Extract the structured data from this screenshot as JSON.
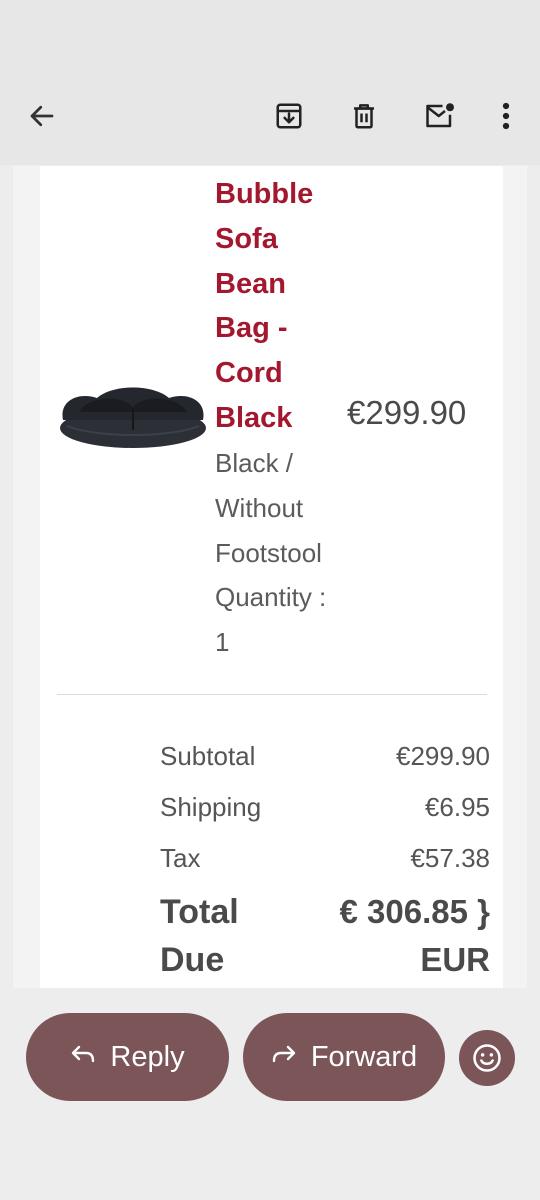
{
  "toolbar": {
    "back_icon": "arrow-left-icon",
    "archive_icon": "archive-icon",
    "delete_icon": "trash-icon",
    "mark_unread_icon": "mail-unread-icon",
    "more_icon": "more-vertical-icon"
  },
  "product": {
    "title_lines": [
      "Bubble",
      "Sofa",
      "Bean",
      "Bag -",
      "Cord",
      "Black"
    ],
    "variant_lines": [
      "Black /",
      "Without",
      "Footstool",
      "Quantity :",
      "1"
    ],
    "price": "€299.90",
    "image": "bean-bag-sofa-image"
  },
  "summary": {
    "subtotal_label": "Subtotal",
    "subtotal_value": "€299.90",
    "shipping_label": "Shipping",
    "shipping_value": "€6.95",
    "tax_label": "Tax",
    "tax_value": "€57.38",
    "total_label_lines": [
      "Total",
      "Due"
    ],
    "total_value_lines": [
      "€ 306.85 }",
      "EUR"
    ]
  },
  "actions": {
    "reply_label": "Reply",
    "forward_label": "Forward",
    "emoji_icon": "smiley-icon"
  },
  "colors": {
    "title_red": "#a3182f",
    "pill_bg": "#7b5557"
  }
}
